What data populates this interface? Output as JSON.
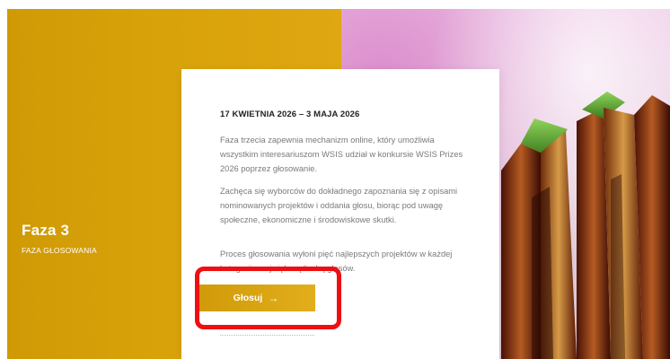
{
  "phase": {
    "title": "Faza 3",
    "subtitle": "FAZA GŁOSOWANIA"
  },
  "card": {
    "date_range": "17 KWIETNIA 2026 – 3 MAJA 2026",
    "paragraphs": [
      "Faza trzecia zapewnia mechanizm online, który umożliwia wszystkim interesariuszom WSIS udział w konkursie WSIS Prizes 2026 poprzez głosowanie.",
      "Zachęca się wyborców do dokładnego zapoznania się z opisami nominowanych projektów i oddania głosu, biorąc pod uwagę społeczne, ekonomiczne i środowiskowe skutki.",
      "Proces głosowania wyłoni pięć najlepszych projektów w każdej kategorii z największą liczbą głosów."
    ],
    "vote_button": {
      "label": "Głosuj",
      "icon": "arrow-right-icon"
    }
  },
  "colors": {
    "gold": "#d8a20a",
    "highlight": "#ee0f12",
    "background": "#ffffff"
  }
}
